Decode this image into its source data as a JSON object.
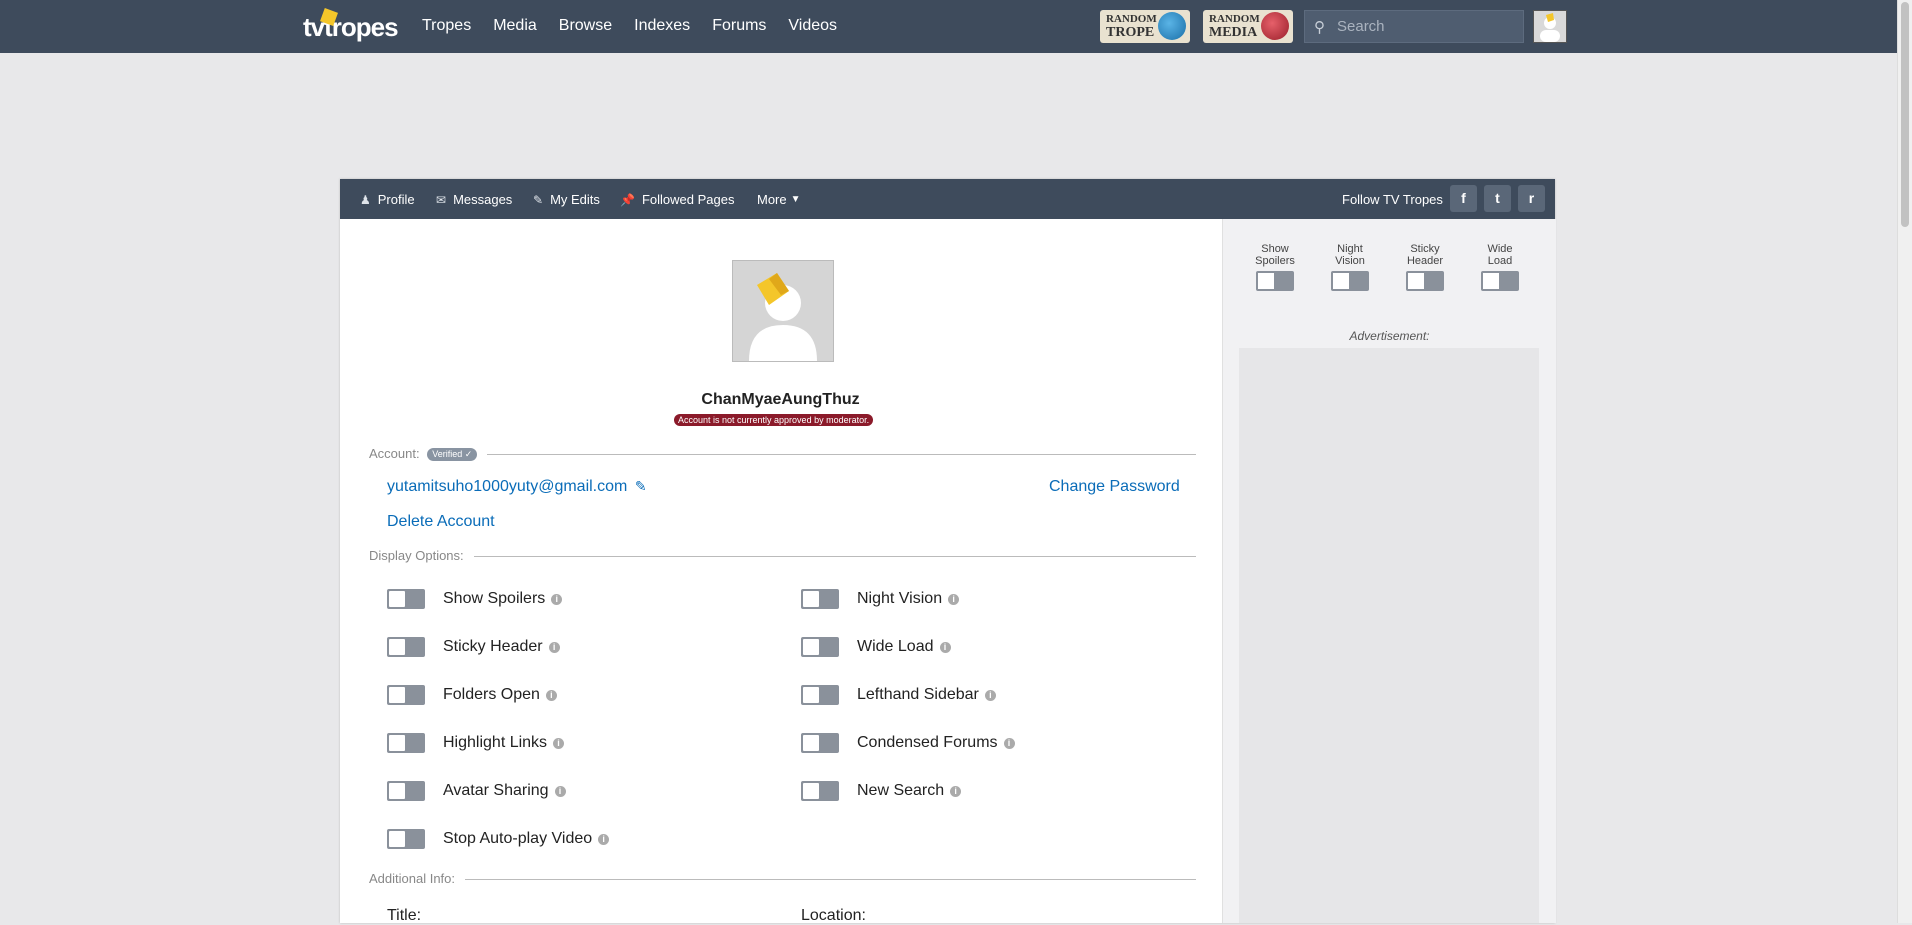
{
  "topbar": {
    "logo": "tvtropes",
    "nav": [
      "Tropes",
      "Media",
      "Browse",
      "Indexes",
      "Forums",
      "Videos"
    ],
    "random_trope": [
      "RANDOM",
      "TROPE"
    ],
    "random_media": [
      "RANDOM",
      "MEDIA"
    ],
    "search_placeholder": "Search"
  },
  "panel": {
    "tabs": [
      "Profile",
      "Messages",
      "My Edits",
      "Followed Pages",
      "More"
    ],
    "follow_label": "Follow TV Tropes",
    "social": [
      "f",
      "t",
      "r"
    ]
  },
  "profile": {
    "username": "ChanMyaeAungThuz",
    "status_badge": "Account is not currently approved by moderator."
  },
  "account": {
    "section_label": "Account:",
    "verified_badge": "Verified",
    "email": "yutamitsuho1000yuty@gmail.com",
    "change_password": "Change Password",
    "delete_account": "Delete Account"
  },
  "display": {
    "section_label": "Display Options:",
    "options_left": [
      "Show Spoilers",
      "Sticky Header",
      "Folders Open",
      "Highlight Links",
      "Avatar Sharing",
      "Stop Auto-play Video"
    ],
    "options_right": [
      "Night Vision",
      "Wide Load",
      "Lefthand Sidebar",
      "Condensed Forums",
      "New Search"
    ]
  },
  "additional": {
    "section_label": "Additional Info:",
    "title_label": "Title:",
    "location_label": "Location:"
  },
  "sidebar": {
    "quick_toggles": [
      {
        "l1": "Show",
        "l2": "Spoilers"
      },
      {
        "l1": "Night",
        "l2": "Vision"
      },
      {
        "l1": "Sticky",
        "l2": "Header"
      },
      {
        "l1": "Wide",
        "l2": "Load"
      }
    ],
    "ad_label": "Advertisement:"
  },
  "colors": {
    "header_bg": "#3e4b5c",
    "link": "#0a6cb8",
    "badge_red": "#8b1a2a",
    "toggle_off": "#8a919b"
  }
}
